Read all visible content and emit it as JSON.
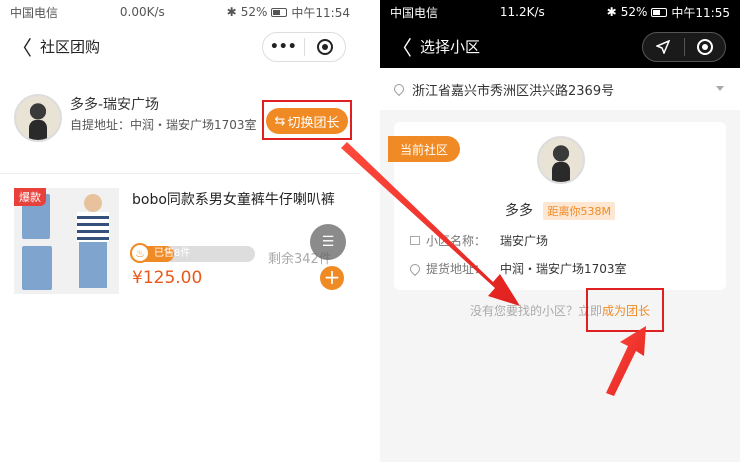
{
  "left_screen": {
    "status": {
      "carrier": "中国电信",
      "speed": "0.00K/s",
      "battery": "52%",
      "time": "中午11:54"
    },
    "nav": {
      "title": "社区团购",
      "back_glyph": "〈",
      "more_glyph": "•••"
    },
    "leader": {
      "name": "多多-瑞安广场",
      "address": "自提地址：中润・瑞安广场1703室",
      "switch_label": "切换团长"
    },
    "product": {
      "badge": "爆款",
      "title": "bobo同款系男女童裤牛仔喇叭裤",
      "sold_text": "已售8件",
      "sold_ratio": 0.35,
      "price": "¥125.00",
      "remaining": "剩余342件"
    }
  },
  "right_screen": {
    "status": {
      "carrier": "中国电信",
      "speed": "11.2K/s",
      "battery": "52%",
      "time": "中午11:55"
    },
    "nav": {
      "title": "选择小区",
      "back_glyph": "〈"
    },
    "location": "浙江省嘉兴市秀洲区洪兴路2369号",
    "card": {
      "tag": "当前社区",
      "leader_name": "多多",
      "distance": "距离你538M",
      "community_label": "小区名称：",
      "community_value": "瑞安广场",
      "pickup_label": "提货地址：",
      "pickup_value": "中润・瑞安广场1703室"
    },
    "not_found_text": "没有您要找的小区？立即",
    "become_leader": "成为团长"
  },
  "colors": {
    "accent": "#f08a24",
    "highlight_red": "#e02020"
  }
}
